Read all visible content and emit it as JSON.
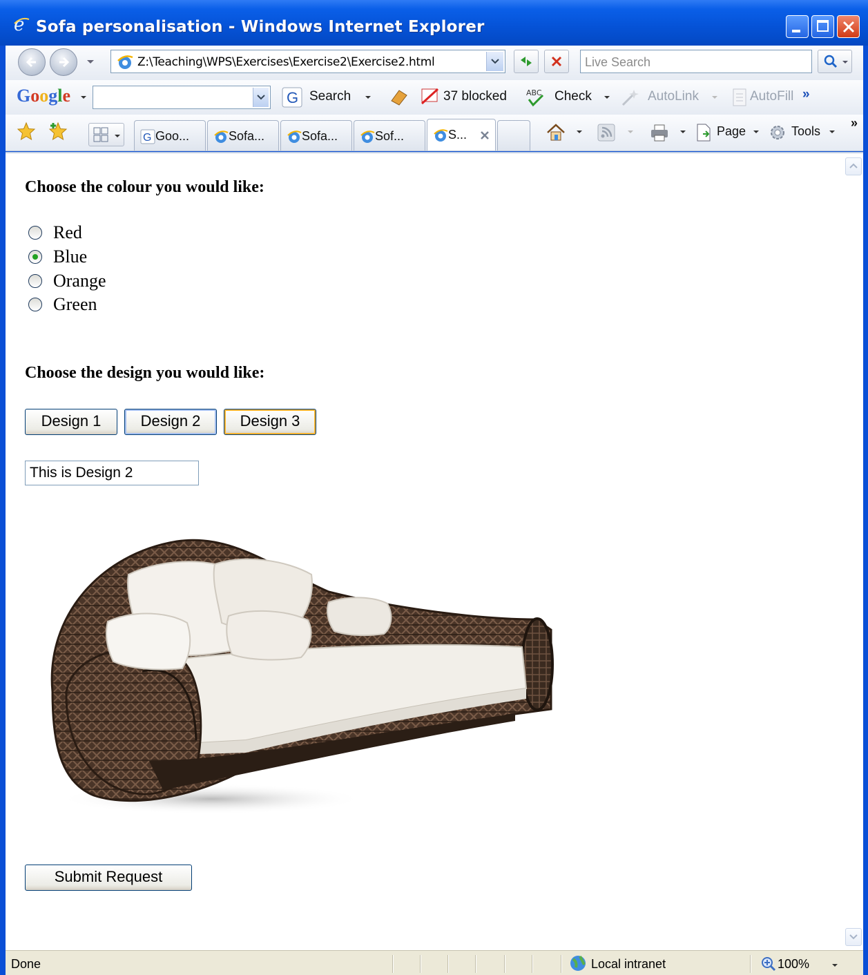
{
  "window": {
    "title": "Sofa personalisation - Windows Internet Explorer"
  },
  "address_bar": {
    "url": "Z:\\Teaching\\WPS\\Exercises\\Exercise2\\Exercise2.html",
    "search_placeholder": "Live Search"
  },
  "google_toolbar": {
    "logo": "Google",
    "search_label": "Search",
    "blocked_label": "37 blocked",
    "check_label": "Check",
    "autolink_label": "AutoLink",
    "autofill_label": "AutoFill",
    "more": "»"
  },
  "tabs": [
    {
      "label": "Goo..."
    },
    {
      "label": "Sofa..."
    },
    {
      "label": "Sofa..."
    },
    {
      "label": "Sof..."
    },
    {
      "label": "S..."
    }
  ],
  "command_bar": {
    "page_label": "Page",
    "tools_label": "Tools",
    "more": "»"
  },
  "page": {
    "colour_heading": "Choose the colour you would like:",
    "colours": [
      {
        "label": "Red",
        "checked": false
      },
      {
        "label": "Blue",
        "checked": true
      },
      {
        "label": "Orange",
        "checked": false
      },
      {
        "label": "Green",
        "checked": false
      }
    ],
    "design_heading": "Choose the design you would like:",
    "design_buttons": [
      "Design 1",
      "Design 2",
      "Design 3"
    ],
    "design_text_value": "This is Design 2",
    "submit_label": "Submit Request"
  },
  "status_bar": {
    "status_text": "Done",
    "zone_text": "Local intranet",
    "zoom_text": "100%"
  },
  "colors": {
    "title_bar": "#0552d6",
    "toolbar_bg": "#e6ebf3",
    "status_bg": "#ece9d8",
    "radio_checked": "#21a121"
  }
}
